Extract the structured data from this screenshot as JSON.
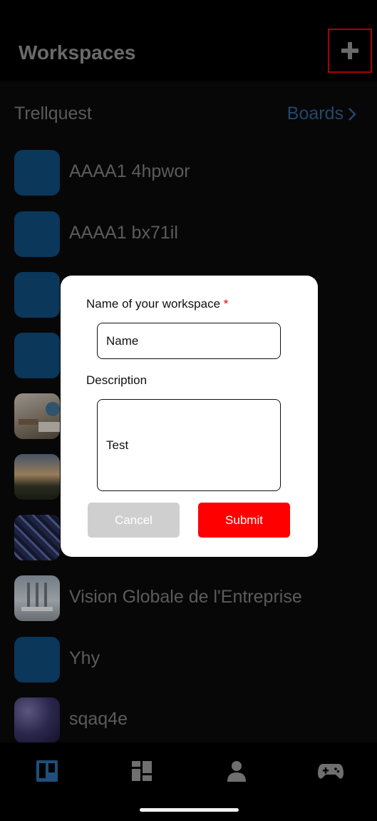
{
  "header": {
    "title": "Workspaces",
    "add_icon": "plus-icon"
  },
  "section": {
    "name": "Trellquest",
    "link_label": "Boards"
  },
  "workspaces": [
    {
      "label": "AAAA1 4hpwor",
      "thumb": "blue"
    },
    {
      "label": "AAAA1 bx71il",
      "thumb": "blue"
    },
    {
      "label": "",
      "thumb": "blue"
    },
    {
      "label": "",
      "thumb": "blue"
    },
    {
      "label": "",
      "thumb": "desk-photo"
    },
    {
      "label": "",
      "thumb": "landscape-photo"
    },
    {
      "label": "",
      "thumb": "architecture-photo"
    },
    {
      "label": "Vision Globale de l'Entreprise",
      "thumb": "office-photo"
    },
    {
      "label": "Yhy",
      "thumb": "blue"
    },
    {
      "label": "sqaq4e",
      "thumb": "galaxy-photo"
    }
  ],
  "modal": {
    "name_label": "Name of your workspace",
    "required_mark": "*",
    "name_value": "Name",
    "description_label": "Description",
    "description_value": "Test",
    "cancel_label": "Cancel",
    "submit_label": "Submit"
  },
  "nav": [
    {
      "icon": "boards-icon",
      "active": true
    },
    {
      "icon": "dashboard-icon",
      "active": false
    },
    {
      "icon": "profile-icon",
      "active": false
    },
    {
      "icon": "gamepad-icon",
      "active": false
    }
  ],
  "colors": {
    "accent": "#ff0000",
    "link": "#2f5f8f",
    "thumb_blue": "#0e4a78",
    "nav_active": "#1f4f7a",
    "nav_inactive": "#6f6f6f"
  }
}
